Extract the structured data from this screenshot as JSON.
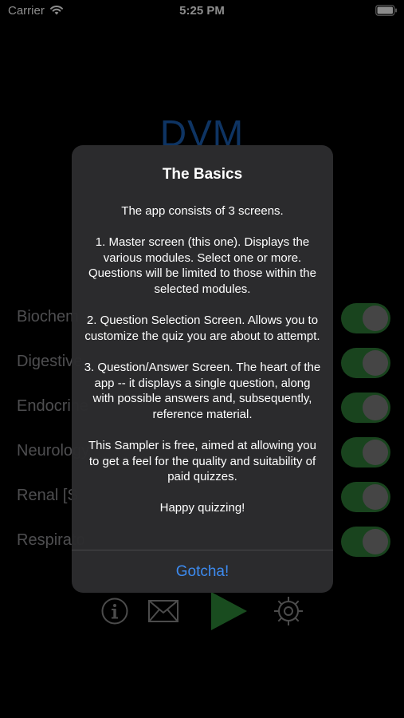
{
  "status_bar": {
    "carrier": "Carrier",
    "time": "5:25 PM"
  },
  "app": {
    "title": "DVM",
    "title_color": "#1a5fb4"
  },
  "modules": [
    {
      "label": "Biochem",
      "enabled": true
    },
    {
      "label": "Digestive",
      "enabled": true
    },
    {
      "label": "Endocrine",
      "enabled": true
    },
    {
      "label": "Neurology",
      "enabled": true
    },
    {
      "label": "Renal [S",
      "enabled": true
    },
    {
      "label": "Respirato",
      "enabled": true
    }
  ],
  "toolbar": {
    "icons": [
      "info-icon",
      "mail-icon",
      "play-icon",
      "gear-icon"
    ],
    "play_color": "#2e8b3a"
  },
  "alert": {
    "title": "The Basics",
    "paragraphs": [
      "The app consists of 3 screens.",
      "1. Master screen (this one). Displays the various modules. Select one or more. Questions will be limited to those within the selected modules.",
      "2. Question Selection Screen. Allows you to customize the quiz you are about to attempt.",
      "3. Question/Answer Screen. The heart of the app -- it displays a single question, along with possible answers and, subsequently, reference material.",
      "This Sampler is free, aimed at allowing you to get a feel for the quality and suitability of paid quizzes.",
      "Happy quizzing!"
    ],
    "button_label": "Gotcha!",
    "button_color": "#3d8bf0"
  }
}
